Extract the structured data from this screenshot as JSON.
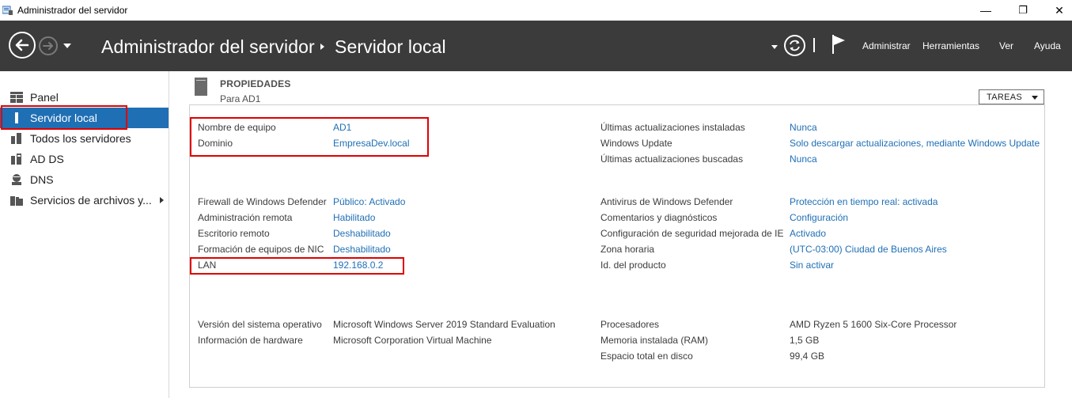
{
  "window": {
    "title": "Administrador del servidor",
    "minimize": "—",
    "restore": "❐",
    "close": "✕"
  },
  "header": {
    "breadcrumb_root": "Administrador del servidor",
    "breadcrumb_current": "Servidor local",
    "menu": [
      "Administrar",
      "Herramientas",
      "Ver",
      "Ayuda"
    ]
  },
  "sidebar": {
    "items": [
      {
        "label": "Panel",
        "icon": "dashboard-icon"
      },
      {
        "label": "Servidor local",
        "icon": "server-icon"
      },
      {
        "label": "Todos los servidores",
        "icon": "servers-icon"
      },
      {
        "label": "AD DS",
        "icon": "ad-ds-icon"
      },
      {
        "label": "DNS",
        "icon": "dns-icon"
      },
      {
        "label": "Servicios de archivos y...",
        "icon": "file-services-icon"
      }
    ]
  },
  "properties": {
    "title": "PROPIEDADES",
    "subtitle": "Para AD1",
    "tasks_label": "TAREAS",
    "left": [
      {
        "label": "Nombre de equipo",
        "value": "AD1",
        "link": true
      },
      {
        "label": "Dominio",
        "value": "EmpresaDev.local",
        "link": true
      },
      {
        "label": "Firewall de Windows Defender",
        "value": "Público: Activado",
        "link": true
      },
      {
        "label": "Administración remota",
        "value": "Habilitado",
        "link": true
      },
      {
        "label": "Escritorio remoto",
        "value": "Deshabilitado",
        "link": true
      },
      {
        "label": "Formación de equipos de NIC",
        "value": "Deshabilitado",
        "link": true
      },
      {
        "label": "LAN",
        "value": "192.168.0.2",
        "link": true
      },
      {
        "label": "Versión del sistema operativo",
        "value": "Microsoft Windows Server 2019 Standard Evaluation",
        "link": false
      },
      {
        "label": "Información de hardware",
        "value": "Microsoft Corporation Virtual Machine",
        "link": false
      }
    ],
    "right": [
      {
        "label": "Últimas actualizaciones instaladas",
        "value": "Nunca",
        "link": true
      },
      {
        "label": "Windows Update",
        "value": "Solo descargar actualizaciones, mediante Windows Update",
        "link": true
      },
      {
        "label": "Últimas actualizaciones buscadas",
        "value": "Nunca",
        "link": true
      },
      {
        "label": "Antivirus de Windows Defender",
        "value": "Protección en tiempo real: activada",
        "link": true
      },
      {
        "label": "Comentarios y diagnósticos",
        "value": "Configuración",
        "link": true
      },
      {
        "label": "Configuración de seguridad mejorada de IE",
        "value": "Activado",
        "link": true
      },
      {
        "label": "Zona horaria",
        "value": "(UTC-03:00) Ciudad de Buenos Aires",
        "link": true
      },
      {
        "label": "Id. del producto",
        "value": "Sin activar",
        "link": true
      },
      {
        "label": "Procesadores",
        "value": "AMD Ryzen 5 1600 Six-Core Processor",
        "link": false
      },
      {
        "label": "Memoria instalada (RAM)",
        "value": "1,5 GB",
        "link": false
      },
      {
        "label": "Espacio total en disco",
        "value": "99,4 GB",
        "link": false
      }
    ]
  },
  "colors": {
    "header_bg": "#3b3b3b",
    "selection": "#1f6fb5",
    "link": "#1f6fb5",
    "highlight_box": "#e00000"
  }
}
